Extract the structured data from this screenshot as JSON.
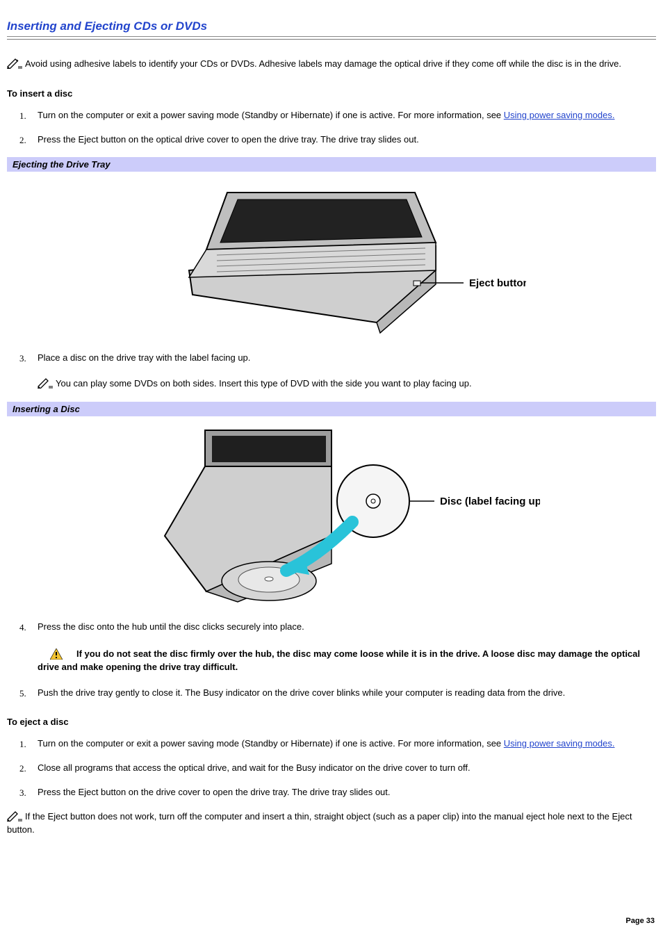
{
  "title": "Inserting and Ejecting CDs or DVDs",
  "intro": "Avoid using adhesive labels to identify your CDs or DVDs. Adhesive labels may damage the optical drive if they come off while the disc is in the drive.",
  "section_insert": "To insert a disc",
  "insert": {
    "step1_a": "Turn on the computer or exit a power saving mode (Standby or Hibernate) if one is active. For more information, see ",
    "step1_link": "Using power saving modes.",
    "step2": "Press the Eject button on the optical drive cover to open the drive tray. The drive tray slides out.",
    "step3": "Place a disc on the drive tray with the label facing up.",
    "step3_note": "You can play some DVDs on both sides. Insert this type of DVD with the side you want to play facing up.",
    "step4": "Press the disc onto the hub until the disc clicks securely into place.",
    "step4_warn": "If you do not seat the disc firmly over the hub, the disc may come loose while it is in the drive. A loose disc may damage the optical drive and make opening the drive tray difficult.",
    "step5": "Push the drive tray gently to close it. The Busy indicator on the drive cover blinks while your computer is reading data from the drive."
  },
  "bar1": "Ejecting the Drive Tray",
  "bar2": "Inserting a Disc",
  "fig1_callout": "Eject button",
  "fig2_callout": "Disc (label facing up)",
  "section_eject": "To eject a disc",
  "eject": {
    "step1_a": "Turn on the computer or exit a power saving mode (Standby or Hibernate) if one is active. For more information, see ",
    "step1_link": "Using power saving modes.",
    "step2": "Close all programs that access the optical drive, and wait for the Busy indicator on the drive cover to turn off.",
    "step3": "Press the Eject button on the drive cover to open the drive tray. The drive tray slides out.",
    "end_note": "If the Eject button does not work, turn off the computer and insert a thin, straight object (such as a paper clip) into the manual eject hole next to the Eject button."
  },
  "page_num": "Page 33"
}
